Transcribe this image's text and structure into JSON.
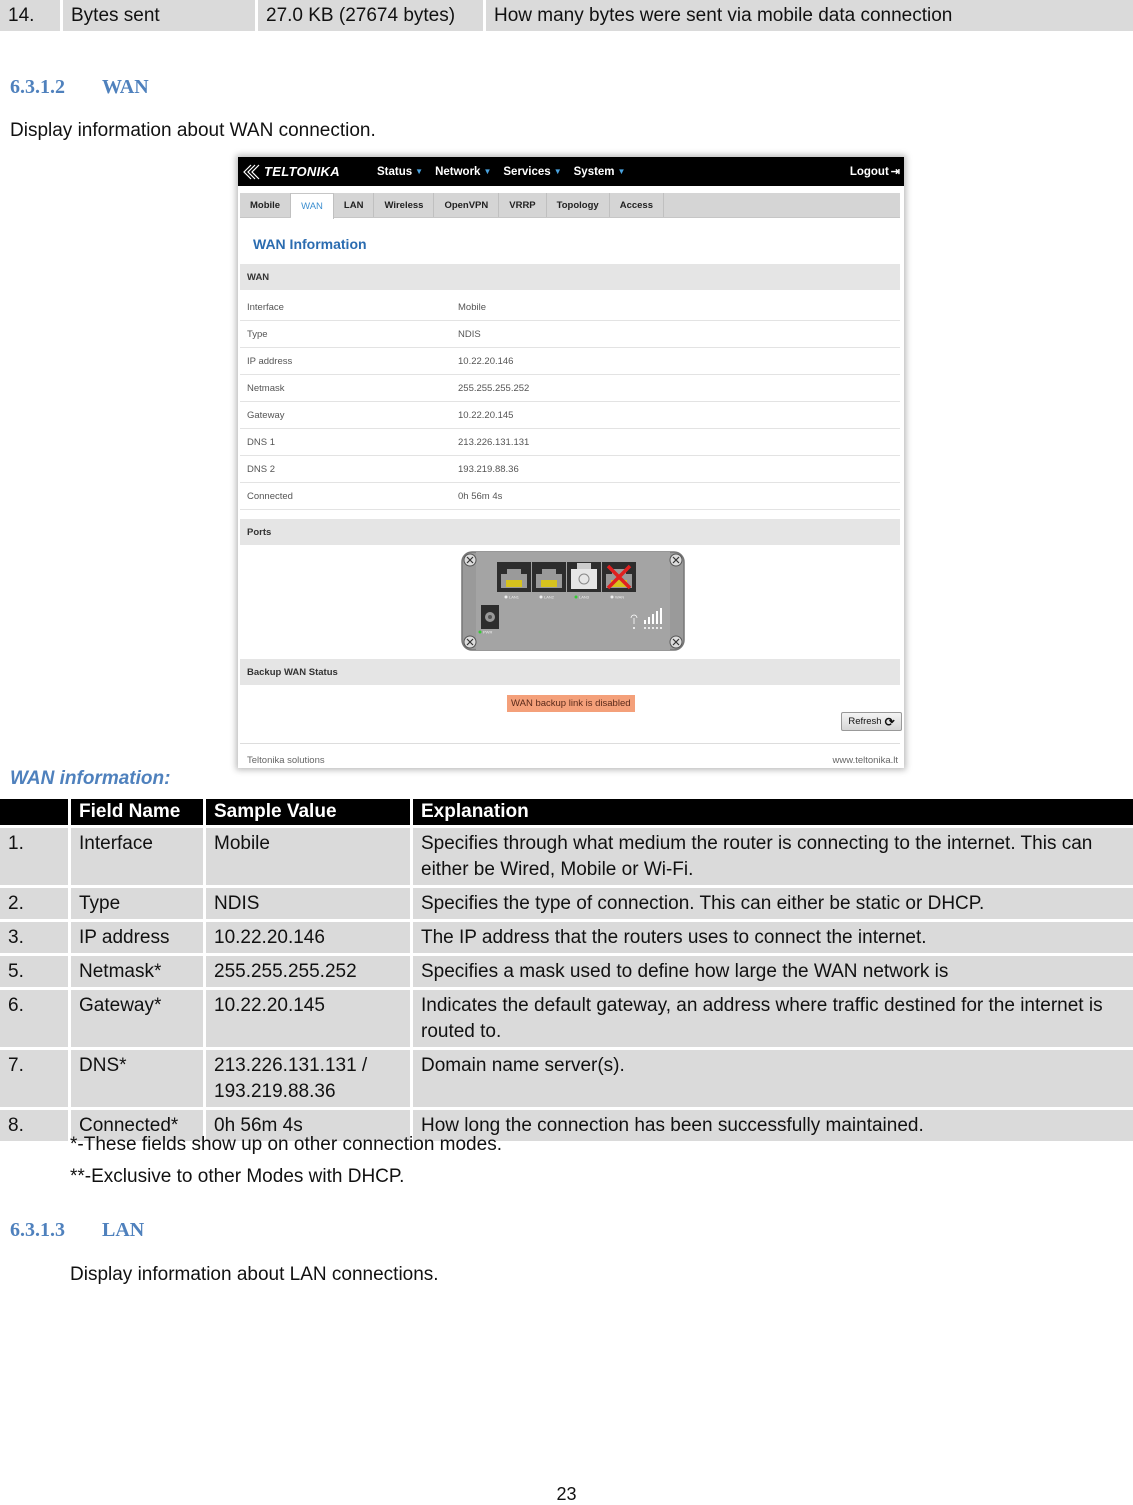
{
  "top_table": {
    "rows": [
      {
        "num": "14.",
        "field": "Bytes sent",
        "value": "27.0 KB (27674 bytes)",
        "explanation": "How many bytes were sent via mobile data connection"
      }
    ]
  },
  "section_wan": {
    "number": "6.3.1.2",
    "title": "WAN",
    "intro": "Display information about WAN connection."
  },
  "screenshot": {
    "brand": "TELTONIKA",
    "nav": [
      {
        "label": "Status"
      },
      {
        "label": "Network"
      },
      {
        "label": "Services"
      },
      {
        "label": "System"
      }
    ],
    "logout": "Logout",
    "tabs": [
      {
        "label": "Mobile",
        "active": false
      },
      {
        "label": "WAN",
        "active": true
      },
      {
        "label": "LAN",
        "active": false
      },
      {
        "label": "Wireless",
        "active": false
      },
      {
        "label": "OpenVPN",
        "active": false
      },
      {
        "label": "VRRP",
        "active": false
      },
      {
        "label": "Topology",
        "active": false
      },
      {
        "label": "Access",
        "active": false
      }
    ],
    "page_title": "WAN Information",
    "wan_section": "WAN",
    "wan_rows": [
      {
        "key": "Interface",
        "value": "Mobile"
      },
      {
        "key": "Type",
        "value": "NDIS"
      },
      {
        "key": "IP address",
        "value": "10.22.20.146"
      },
      {
        "key": "Netmask",
        "value": "255.255.255.252"
      },
      {
        "key": "Gateway",
        "value": "10.22.20.145"
      },
      {
        "key": "DNS 1",
        "value": "213.226.131.131"
      },
      {
        "key": "DNS 2",
        "value": "193.219.88.36"
      },
      {
        "key": "Connected",
        "value": "0h 56m 4s"
      }
    ],
    "ports_section": "Ports",
    "ports": [
      {
        "label": "LAN1",
        "type": "rj45",
        "led": "off"
      },
      {
        "label": "LAN2",
        "type": "rj45",
        "led": "off"
      },
      {
        "label": "LAN3",
        "type": "sfp",
        "led": "on"
      },
      {
        "label": "WAN",
        "type": "rj45",
        "led": "off",
        "disconnected": true
      }
    ],
    "power_label": "PWR",
    "backup_section": "Backup WAN Status",
    "backup_message": "WAN backup link is disabled",
    "refresh_label": "Refresh",
    "footer_left": "Teltonika solutions",
    "footer_right": "www.teltonika.lt",
    "colors": {
      "accent": "#3d8fd0",
      "warning": "#f4a07a",
      "disconnect": "#e02020",
      "led_on": "#33cc33"
    }
  },
  "wan_info_caption": "WAN information:",
  "wan_table": {
    "headers": [
      "",
      "Field Name",
      "Sample Value",
      "Explanation"
    ],
    "rows": [
      {
        "num": "1.",
        "field": "Interface",
        "value": "Mobile",
        "explanation": "Specifies through what medium the router is connecting to the internet. This can either be Wired, Mobile or Wi-Fi."
      },
      {
        "num": "2.",
        "field": "Type",
        "value": "NDIS",
        "explanation": "Specifies the type of connection. This can either be static or DHCP."
      },
      {
        "num": "3.",
        "field": "IP address",
        "value": "10.22.20.146",
        "explanation": "The IP address that the routers uses to connect the internet."
      },
      {
        "num": "5.",
        "field": "Netmask*",
        "value": "255.255.255.252",
        "explanation": "Specifies a mask used to define how large the WAN network is"
      },
      {
        "num": "6.",
        "field": "Gateway*",
        "value": "10.22.20.145",
        "explanation": "Indicates the default gateway, an address where traffic destined for the internet is routed to."
      },
      {
        "num": "7.",
        "field": "DNS*",
        "value": "213.226.131.131 / 193.219.88.36",
        "explanation": "Domain name server(s)."
      },
      {
        "num": "8.",
        "field": "Connected*",
        "value": "0h 56m 4s",
        "explanation": "How long the connection has been successfully maintained."
      }
    ]
  },
  "notes": [
    "*-These fields show up on other connection modes.",
    "**-Exclusive to other Modes with DHCP."
  ],
  "section_lan": {
    "number": "6.3.1.3",
    "title": "LAN",
    "intro": "Display information about LAN connections."
  },
  "page_number": "23"
}
